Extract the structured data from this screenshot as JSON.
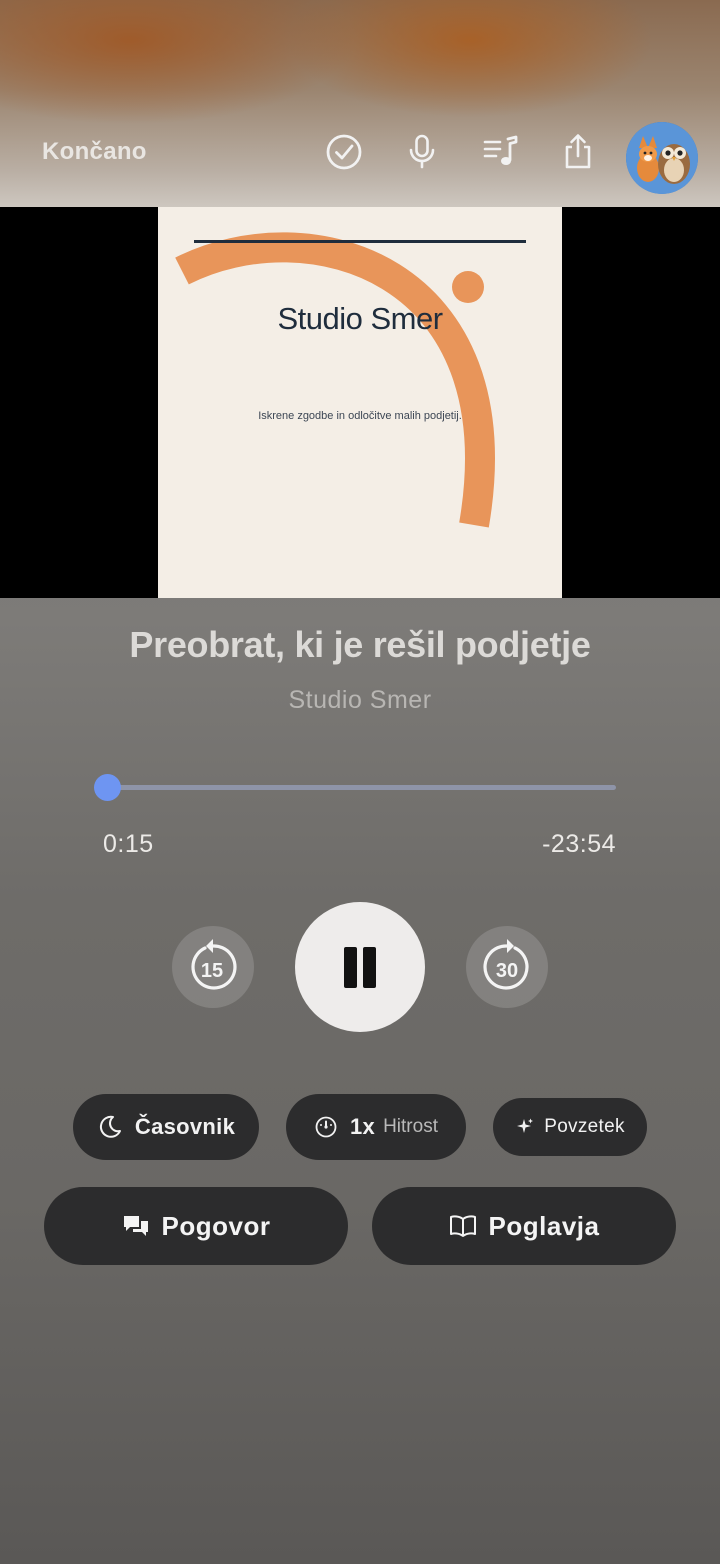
{
  "header": {
    "done_label": "Končano",
    "icons": [
      "checkmark-circle-icon",
      "microphone-icon",
      "playlist-icon",
      "share-icon"
    ],
    "avatar": "avatar"
  },
  "cover": {
    "title": "Studio Smer",
    "subtitle": "Iskrene zgodbe in odločitve malih podjetij.",
    "accent_color": "#e8955a",
    "text_color": "#1f2d3d",
    "background_color": "#f4eee6"
  },
  "episode": {
    "title": "Preobrat, ki je rešil podjetje",
    "show": "Studio Smer"
  },
  "progress": {
    "elapsed": "0:15",
    "remaining": "-23:54",
    "fraction": 0.01,
    "color": "#6e95f2"
  },
  "controls": {
    "skip_back": "15",
    "skip_forward": "30",
    "state": "playing"
  },
  "options": {
    "timer_label": "Časovnik",
    "speed_value": "1x",
    "speed_label": "Hitrost",
    "summary_label": "Povzetek"
  },
  "actions": {
    "conversation_label": "Pogovor",
    "chapters_label": "Poglavja"
  }
}
